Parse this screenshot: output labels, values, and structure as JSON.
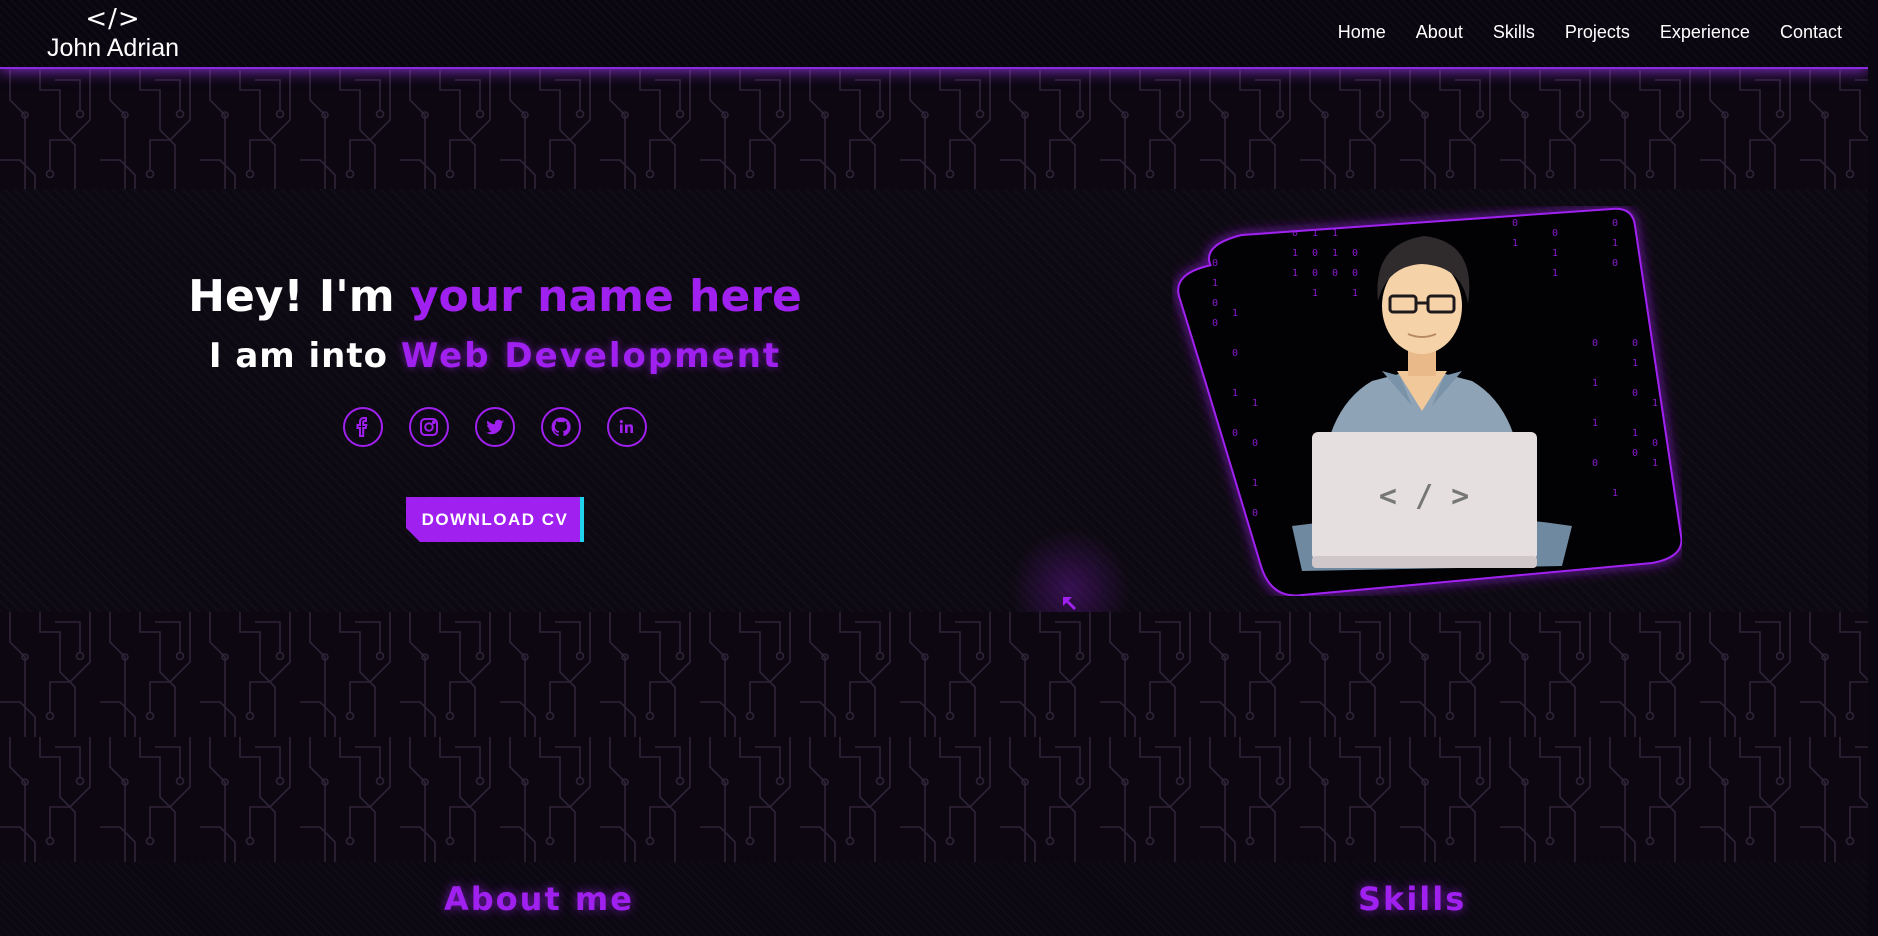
{
  "brand": {
    "logo": "</>",
    "name": "John Adrian"
  },
  "nav": {
    "links": [
      "Home",
      "About",
      "Skills",
      "Projects",
      "Experience",
      "Contact"
    ]
  },
  "hero": {
    "greeting_prefix": "Hey! I'm ",
    "greeting_name": "your name here",
    "subline_prefix": "I am into ",
    "subline_typed": "Web Development",
    "socials": [
      "facebook-icon",
      "instagram-icon",
      "twitter-icon",
      "github-icon",
      "linkedin-icon"
    ],
    "download_cv_label": "DOWNLOAD CV",
    "illustration_code_label": "< / >"
  },
  "sections": {
    "about_heading": "About me",
    "skills_heading": "Skills"
  },
  "colors": {
    "accent": "#a020f0",
    "cyan": "#22d3ee",
    "background": "#0c0812"
  }
}
